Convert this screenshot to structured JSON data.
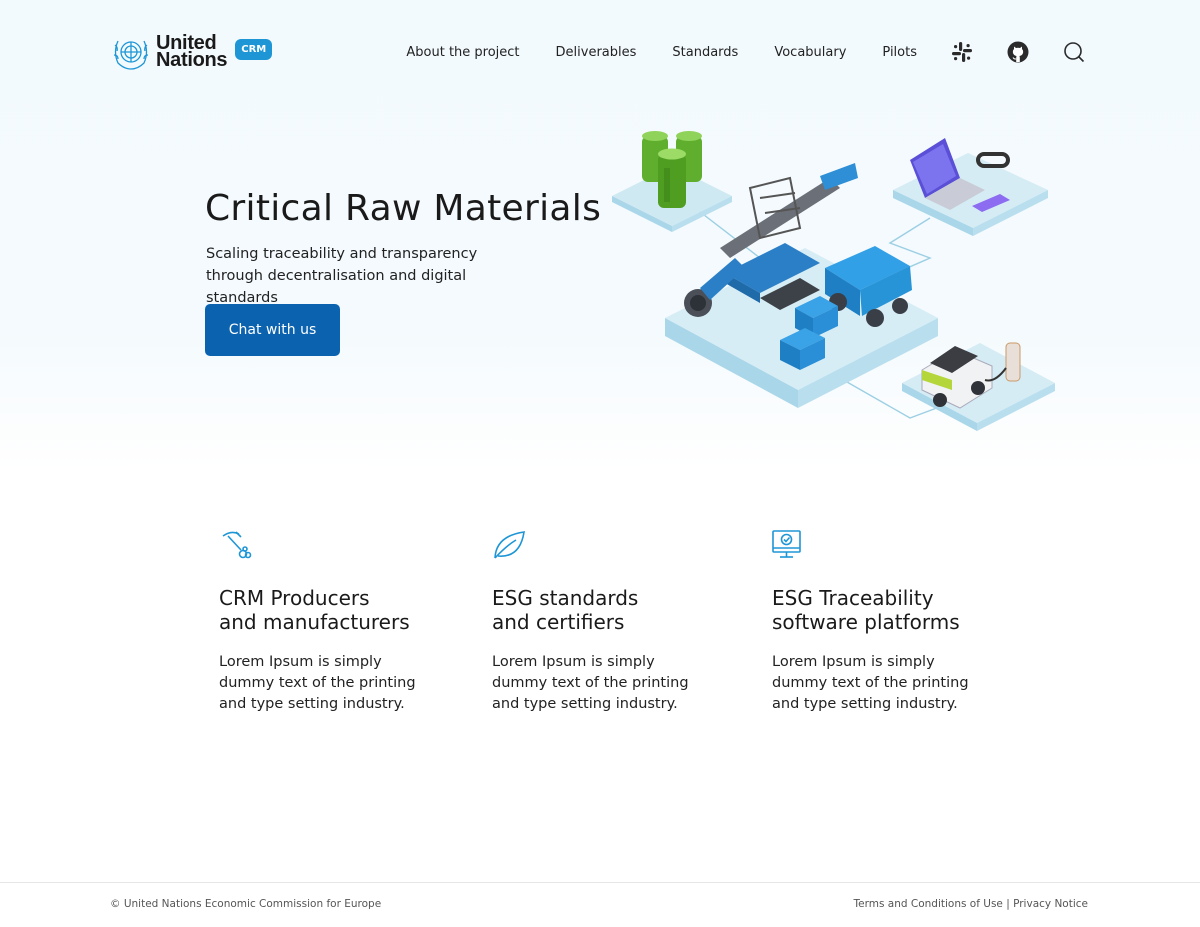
{
  "header": {
    "logo_line1": "United",
    "logo_line2": "Nations",
    "logo_badge": "CRM",
    "nav": [
      "About the project",
      "Deliverables",
      "Standards",
      "Vocabulary",
      "Pilots"
    ],
    "icons": [
      "slack-icon",
      "github-icon",
      "search-icon"
    ]
  },
  "hero": {
    "title": "Critical Raw Materials",
    "subtitle": "Scaling traceability and transparency through decentralisation and digital standards",
    "cta_label": "Chat with us"
  },
  "features": [
    {
      "icon": "pickaxe-icon",
      "title_line1": "CRM Producers",
      "title_line2": "and manufacturers",
      "text": "Lorem Ipsum is simply dummy text of the printing and type setting industry."
    },
    {
      "icon": "leaf-icon",
      "title_line1": "ESG standards",
      "title_line2": "and certifiers",
      "text": "Lorem Ipsum is simply dummy text of the printing and type setting industry."
    },
    {
      "icon": "monitor-check-icon",
      "title_line1": "ESG Traceability",
      "title_line2": "software platforms",
      "text": "Lorem Ipsum is simply dummy text of the printing and type setting industry."
    }
  ],
  "footer": {
    "copyright": "© United Nations Economic Commission for Europe",
    "terms": "Terms and Conditions of Use",
    "separator": " | ",
    "privacy": "Privacy Notice"
  },
  "colors": {
    "accent": "#1e96d6",
    "cta": "#0b63b0",
    "hero_bg": "#f3fafd"
  }
}
